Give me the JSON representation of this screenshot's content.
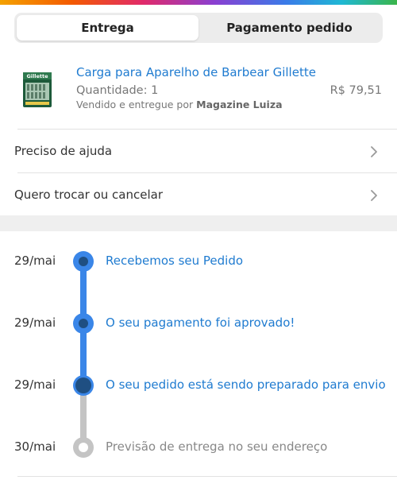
{
  "tabs": [
    {
      "label": "Entrega",
      "active": true
    },
    {
      "label": "Pagamento pedido",
      "active": false
    }
  ],
  "product": {
    "title": "Carga para Aparelho de Barbear Gillette",
    "quantity": "Quantidade: 1",
    "price": "R$ 79,51",
    "seller_prefix": "Vendido e entregue por",
    "seller_name": "Magazine Luiza",
    "image_brand": "Gillette"
  },
  "menu": [
    {
      "label": "Preciso de ajuda",
      "icon": "chevron-right-icon"
    },
    {
      "label": "Quero trocar ou cancelar",
      "icon": "chevron-right-icon"
    }
  ],
  "timeline": [
    {
      "date": "29/mai",
      "text": "Recebemos seu Pedido",
      "status": "done"
    },
    {
      "date": "29/mai",
      "text": "O seu pagamento foi aprovado!",
      "status": "done"
    },
    {
      "date": "29/mai",
      "text": "O seu pedido está sendo preparado para envio",
      "status": "current"
    },
    {
      "date": "30/mai",
      "text": "Previsão de entrega no seu endereço",
      "status": "pending"
    }
  ],
  "colors": {
    "accent_blue": "#3a86e8",
    "dark_blue": "#1f4f82",
    "link_blue": "#1f7bd0",
    "pending_gray": "#c4c4c4"
  }
}
